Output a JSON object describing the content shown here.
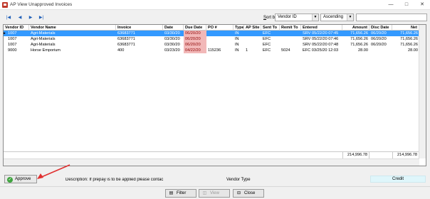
{
  "window": {
    "title": "AP View Unapproved Invoices",
    "minimize": "—",
    "maximize": "□",
    "close": "✕"
  },
  "nav": {
    "first": "|◀",
    "prev": "◀",
    "next": "▶",
    "last": "▶|"
  },
  "sort": {
    "label_prefix": "S",
    "label_rest": "ort by",
    "field": "Vendor ID",
    "order": "Ascending",
    "search_value": ""
  },
  "table": {
    "columns": [
      "Vendor ID",
      "Vendor Name",
      "Invoice",
      "Date",
      "Due Date",
      "PO #",
      "Type",
      "AP Site",
      "Sent To",
      "Remit To",
      "Entered",
      "Amount",
      "Disc Date",
      "Net"
    ],
    "rows": [
      {
        "vendor_id": "1007",
        "vendor_name": "Agri-Materials",
        "invoice": "63683771",
        "date": "03/30/20",
        "due_date": "06/20/20",
        "po": "",
        "type": "IN",
        "ap_site": "",
        "sent_to": "EFC",
        "remit_to": "",
        "entered": "SRV 05/22/20 07:45",
        "amount": "71,656.26",
        "disc_date": "06/20/20",
        "net": "71,656.26"
      },
      {
        "vendor_id": "1007",
        "vendor_name": "Agri-Materials",
        "invoice": "63683771",
        "date": "03/30/20",
        "due_date": "06/20/20",
        "po": "",
        "type": "IN",
        "ap_site": "",
        "sent_to": "EFC",
        "remit_to": "",
        "entered": "SRV 05/22/20 07:46",
        "amount": "71,656.26",
        "disc_date": "06/20/20",
        "net": "71,656.26"
      },
      {
        "vendor_id": "1007",
        "vendor_name": "Agri-Materials",
        "invoice": "63683771",
        "date": "03/30/20",
        "due_date": "06/20/20",
        "po": "",
        "type": "IN",
        "ap_site": "",
        "sent_to": "EFC",
        "remit_to": "",
        "entered": "SRV 05/22/20 07:48",
        "amount": "71,656.26",
        "disc_date": "06/20/20",
        "net": "71,656.26"
      },
      {
        "vendor_id": "9000",
        "vendor_name": "Horse Emporium",
        "invoice": "400",
        "date": "03/23/20",
        "due_date": "04/22/20",
        "po": "115236",
        "type": "IN",
        "ap_site": "1",
        "sent_to": "EFC",
        "remit_to": "5024",
        "entered": "EFC 03/25/20 12:03",
        "amount": "28.00",
        "disc_date": "",
        "net": "28.00"
      }
    ],
    "total_amount": "214,996.78",
    "total_net": "214,996.78",
    "row_indicator": "▶"
  },
  "bottom": {
    "approve_label": "Approve",
    "approve_underline": "A",
    "description": "Description: If prepay is to be applied please contac",
    "vendor_type": "Vendor Type",
    "credit": "Credit"
  },
  "footer": {
    "filter": "Filter",
    "view": "View",
    "close": "Close"
  },
  "colors": {
    "selection": "#3399ff",
    "overdue": "#f2b8b8",
    "annotation_arrow": "#e03030"
  }
}
